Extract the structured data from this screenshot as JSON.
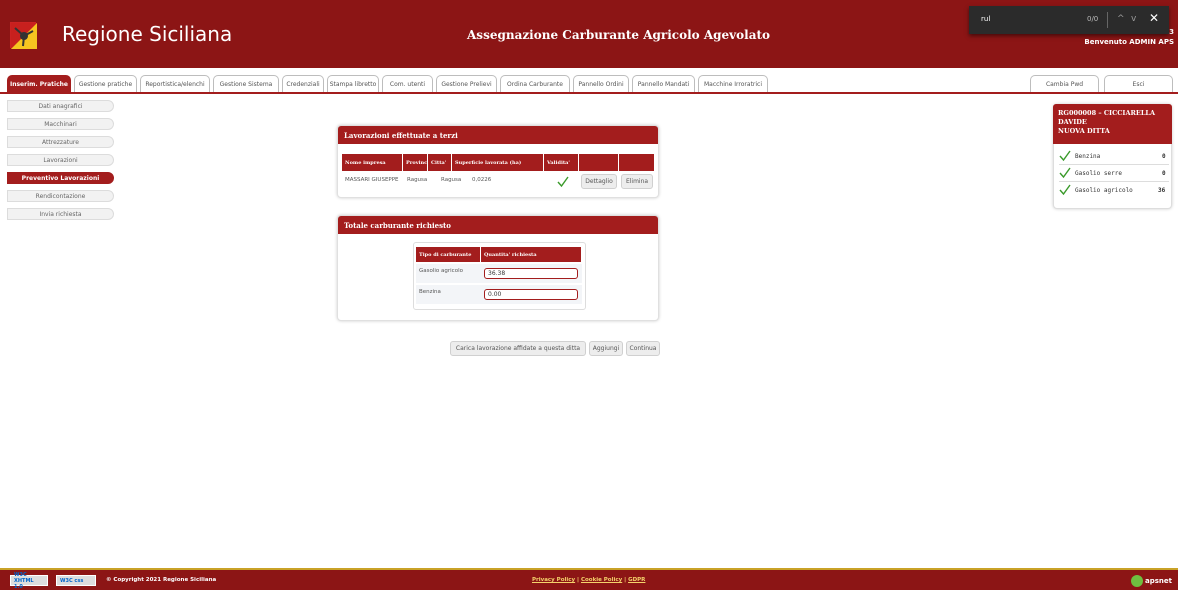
{
  "header": {
    "brand": "Regione Siciliana",
    "app_title": "Assegnazione Carburante Agricolo Agevolato",
    "welcome": "Benvenuto ADMIN APS",
    "id_fragment": "23"
  },
  "findbar": {
    "query": "rul",
    "count": "0/0",
    "prev_icon": "^",
    "next_icon": "v",
    "close_icon": "✕"
  },
  "tabs": [
    {
      "label": "Inserim. Pratiche",
      "active": true
    },
    {
      "label": "Gestione pratiche"
    },
    {
      "label": "Reportistica/elenchi"
    },
    {
      "label": "Gestione Sistema"
    },
    {
      "label": "Credenziali"
    },
    {
      "label": "Stampa libretto"
    },
    {
      "label": "Com. utenti"
    },
    {
      "label": "Gestione Prelievi"
    },
    {
      "label": "Ordina Carburante"
    },
    {
      "label": "Pannello Ordini"
    },
    {
      "label": "Pannello Mandati"
    },
    {
      "label": "Macchine Irroratrici"
    }
  ],
  "right_tabs": {
    "change_pwd": "Cambia Pwd",
    "exit": "Esci"
  },
  "sidebar": {
    "items": [
      {
        "label": "Dati anagrafici"
      },
      {
        "label": "Macchinari"
      },
      {
        "label": "Attrezzature"
      },
      {
        "label": "Lavorazioni"
      },
      {
        "label": "Preventivo Lavorazioni",
        "active": true
      },
      {
        "label": "Rendicontazione"
      },
      {
        "label": "Invia richiesta"
      }
    ]
  },
  "lavorazioni_panel": {
    "title": "Lavorazioni effettuate a terzi",
    "columns": [
      "Nome impresa",
      "Provincia",
      "Citta'",
      "Superficie lavorata (ha)",
      "Validita'",
      "",
      ""
    ],
    "row": {
      "nome_impresa": "MASSARI GIUSEPPE",
      "provincia": "Ragusa",
      "citta": "Ragusa",
      "superficie": "0,0226",
      "dettaglio_label": "Dettaglio",
      "elimina_label": "Elimina"
    }
  },
  "totale_panel": {
    "title": "Totale carburante richiesto",
    "columns": [
      "Tipo di carburante",
      "Quantita' richiesta"
    ],
    "rows": [
      {
        "tipo": "Gasolio agricolo",
        "quantita": "36.38"
      },
      {
        "tipo": "Benzina",
        "quantita": "0.00"
      }
    ]
  },
  "actions": {
    "carica_label": "Carica lavorazione affidate a questa ditta",
    "aggiungi_label": "Aggiungi",
    "continua_label": "Continua"
  },
  "info_box": {
    "line1": "RG000008 – CICCIARELLA",
    "line2": "DAVIDE",
    "line3": "NUOVA DITTA",
    "fuels": [
      {
        "name": "Benzina",
        "value": "0"
      },
      {
        "name": "Gasolio serre",
        "value": "0"
      },
      {
        "name": "Gasolio agricolo",
        "value": "36"
      }
    ]
  },
  "footer": {
    "w3c_xhtml": "W3C XHTML 1.0",
    "w3c_css": "W3C css",
    "copyright": "© Copyright 2021 Regione Siciliana",
    "privacy": "Privacy Policy",
    "cookie": "Cookie Policy",
    "gdpr": "GDPR",
    "sep": "|",
    "brand": "apsnet"
  },
  "colors": {
    "header": "#8c1515",
    "accent": "#a31d1d",
    "footer_link": "#f5d36b",
    "check": "#3a9a2a"
  }
}
